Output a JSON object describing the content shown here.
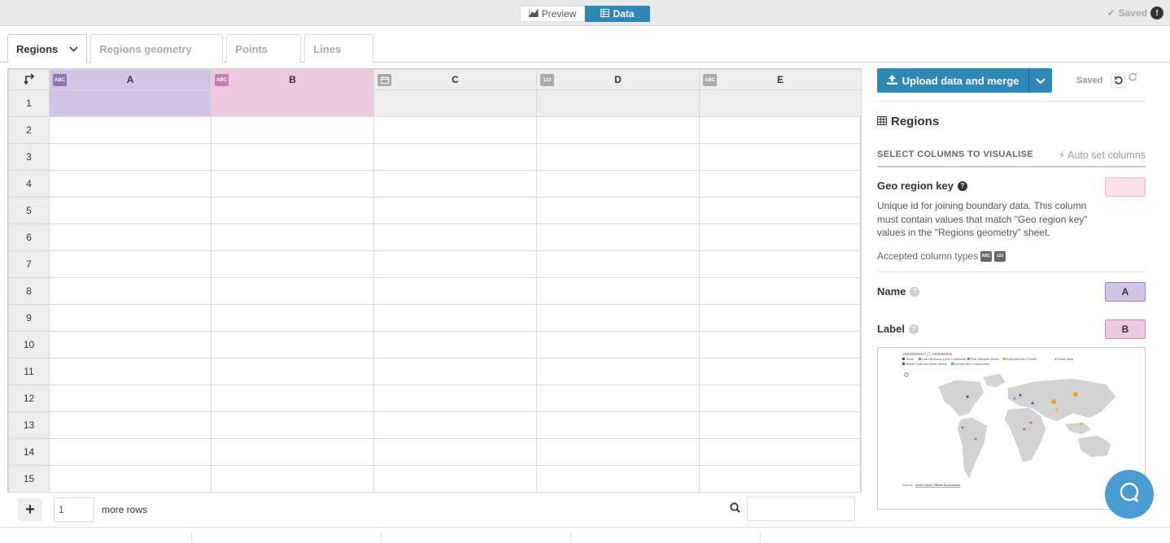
{
  "topbar": {
    "preview_label": "Preview",
    "data_label": "Data",
    "saved_label": "Saved"
  },
  "tabs": [
    {
      "label": "Regions",
      "active": true
    },
    {
      "label": "Regions geometry",
      "active": false
    },
    {
      "label": "Points",
      "active": false
    },
    {
      "label": "Lines",
      "active": false
    }
  ],
  "grid": {
    "columns": [
      {
        "letter": "A",
        "type": "ABC"
      },
      {
        "letter": "B",
        "type": "ABC"
      },
      {
        "letter": "C",
        "type": "date"
      },
      {
        "letter": "D",
        "type": "123"
      },
      {
        "letter": "E",
        "type": "ABC"
      }
    ],
    "rows": [
      "1",
      "2",
      "3",
      "4",
      "5",
      "6",
      "7",
      "8",
      "9",
      "10",
      "11",
      "12",
      "13",
      "14",
      "15"
    ]
  },
  "footer": {
    "rows_value": "1",
    "more_rows_label": "more rows"
  },
  "panel": {
    "upload_label": "Upload data and merge",
    "saved_label": "Saved",
    "title": "Regions",
    "select_columns_label": "SELECT COLUMNS TO VISUALISE",
    "auto_set_label": "Auto set columns",
    "geo_key": {
      "label": "Geo region key",
      "description": "Unique id for joining boundary data. This column must contain values that match \"Geo region key\" values in the \"Regions geometry\" sheet.",
      "accepted_label": "Accepted column types",
      "accepted_types": [
        "ABC",
        "123"
      ]
    },
    "name": {
      "label": "Name",
      "column": "A"
    },
    "label": {
      "label": "Label",
      "column": "B"
    },
    "colors": {
      "name": "#d1c4e6",
      "label": "#ecc8e1",
      "geo": "#fde0ea",
      "accent": "#2f86b8"
    }
  },
  "map_preview": {
    "scale_text": "1000000000 0 ◯ 1000000000",
    "legend": [
      "Other",
      "Latin America & the Caribbean",
      "Sub-Saharan Africa",
      "East Asia and Pacific",
      "South Asia",
      "Middle East and North Africa",
      "Europe and Central Asia"
    ],
    "source_label": "Source:",
    "source_link": "World Bank Official Boundaries"
  }
}
